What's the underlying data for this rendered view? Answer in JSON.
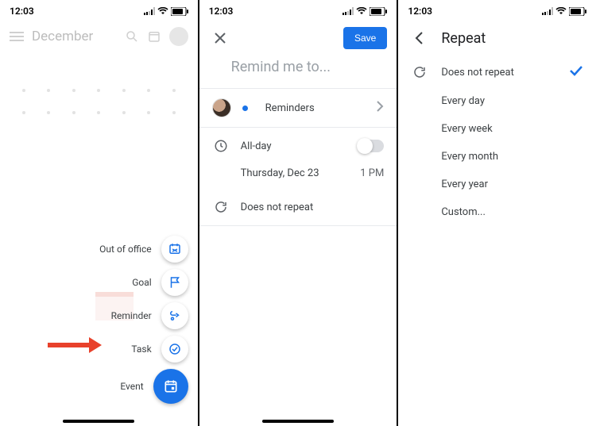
{
  "status": {
    "time": "12:03"
  },
  "panel1": {
    "month": "December",
    "fab": {
      "out_of_office": "Out of office",
      "goal": "Goal",
      "reminder": "Reminder",
      "task": "Task",
      "event": "Event"
    }
  },
  "panel2": {
    "save": "Save",
    "title_placeholder": "Remind me to...",
    "calendar_label": "Reminders",
    "allday_label": "All-day",
    "date_label": "Thursday, Dec 23",
    "time_label": "1 PM",
    "repeat_label": "Does not repeat"
  },
  "panel3": {
    "title": "Repeat",
    "options": {
      "none": "Does not repeat",
      "day": "Every day",
      "week": "Every week",
      "month": "Every month",
      "year": "Every year",
      "custom": "Custom..."
    }
  }
}
